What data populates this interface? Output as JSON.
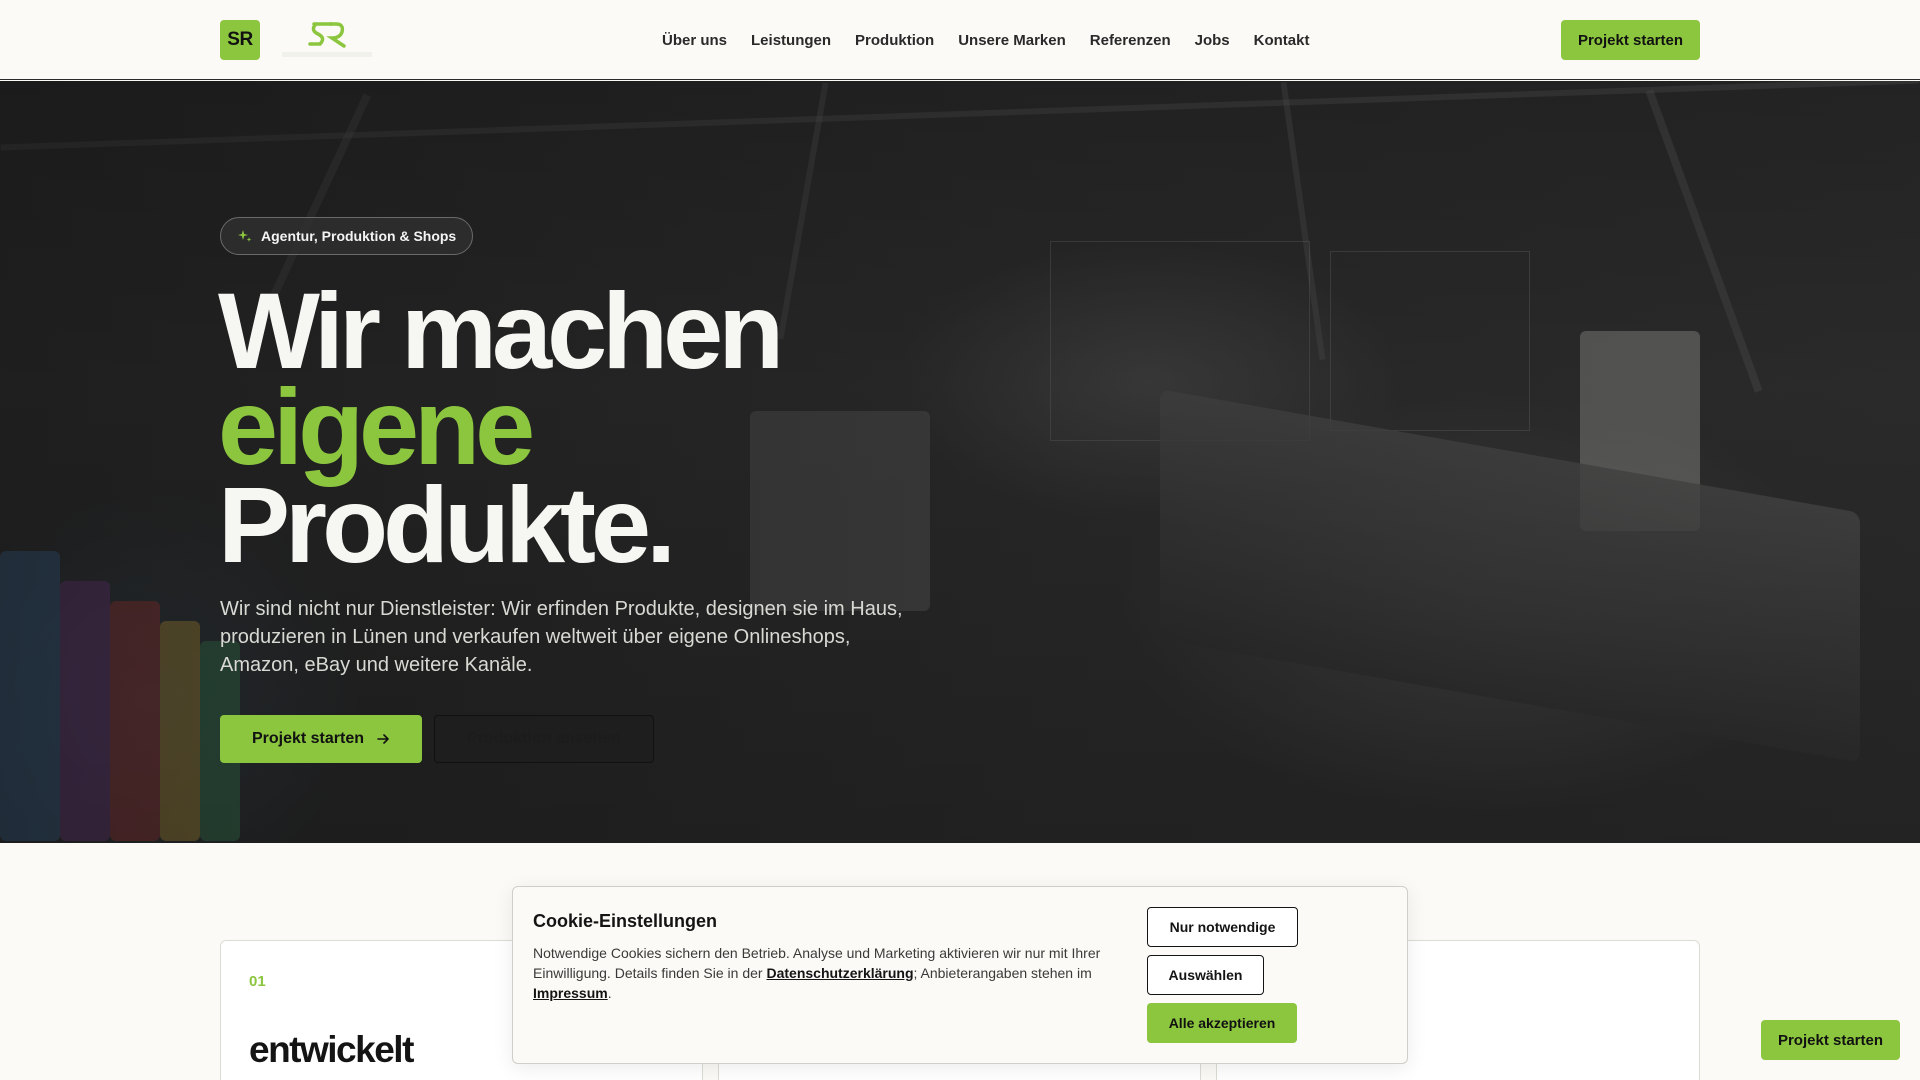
{
  "brand": {
    "logo_text": "SR"
  },
  "nav": {
    "items": [
      {
        "label": "Über uns"
      },
      {
        "label": "Leistungen"
      },
      {
        "label": "Produktion"
      },
      {
        "label": "Unsere Marken"
      },
      {
        "label": "Referenzen"
      },
      {
        "label": "Jobs"
      },
      {
        "label": "Kontakt"
      }
    ],
    "cta_label": "Projekt starten"
  },
  "hero": {
    "badge": "Agentur, Produktion & Shops",
    "headline_1": "Wir machen",
    "headline_2": "eigene",
    "headline_3": "Produkte.",
    "lead": "Wir sind nicht nur Dienstleister: Wir erfinden Produkte, designen sie im Haus, produzieren in Lünen und verkaufen weltweit über eigene Onlineshops, Amazon, eBay und weitere Kanäle.",
    "primary_button": "Projekt starten",
    "secondary_button": "Produktion ansehen"
  },
  "cards": [
    {
      "number": "01",
      "title": "entwickelt"
    }
  ],
  "cookie": {
    "title": "Cookie-Einstellungen",
    "text_before": "Notwendige Cookies sichern den Betrieb. Analyse und Marketing aktivieren wir nur mit Ihrer Einwilligung. Details finden Sie in der ",
    "privacy_link": "Datenschutzerklärung",
    "text_middle": "; Anbieterangaben stehen im ",
    "imprint_link": "Impressum",
    "text_after": ".",
    "btn_necessary": "Nur notwendige",
    "btn_select": "Auswählen",
    "btn_accept": "Alle akzeptieren"
  },
  "floating_cta": "Projekt starten",
  "colors": {
    "accent": "#8cc63f",
    "background": "#fbfaf6",
    "text": "#141414"
  }
}
